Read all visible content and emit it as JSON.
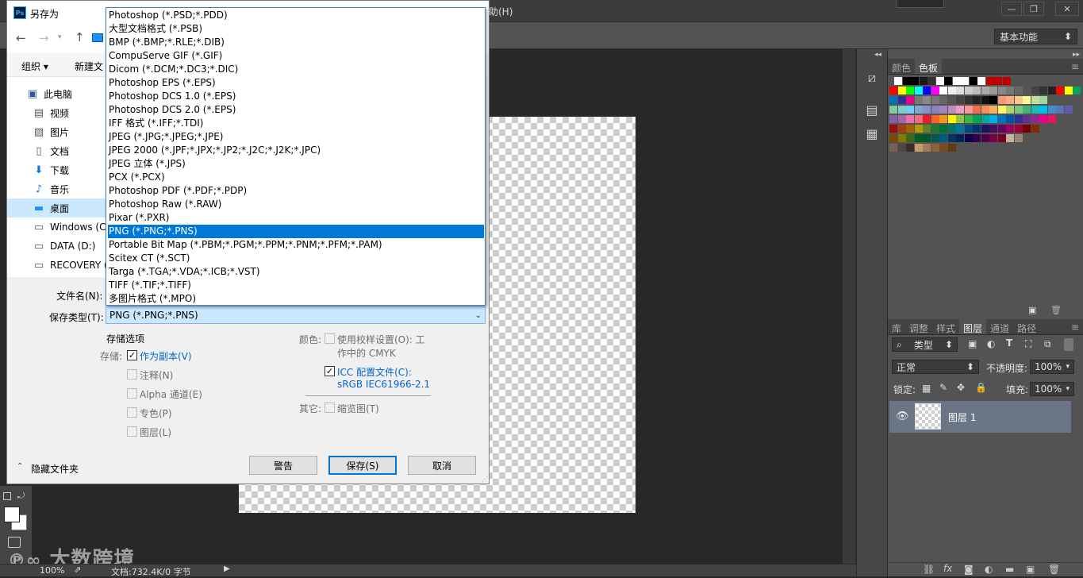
{
  "ps": {
    "menu_help": "助(H)",
    "window_controls": [
      "—",
      "❐",
      "✕"
    ],
    "workspace": "基本功能",
    "zoom": "100%",
    "doc_info": "文档:732.4K/0 字节",
    "watermark": "大数跨境"
  },
  "panels": {
    "color_tabs": [
      "颜色",
      "色板"
    ],
    "layer_tabs": [
      "库",
      "调整",
      "样式",
      "图层",
      "通道",
      "路径"
    ],
    "kind_filter": "类型",
    "blend_mode": "正常",
    "opacity_label": "不透明度:",
    "opacity_value": "100%",
    "lock_label": "锁定:",
    "fill_label": "填充:",
    "fill_value": "100%",
    "layer_name": "图层 1",
    "swatch_rows": [
      [
        "#ffffff",
        "#000000",
        "#000000",
        "#1a1a1a",
        "#333333",
        "#ffffff",
        "#000000",
        "#ffffff",
        "#ffffff",
        "#000000",
        "#ffffff",
        "#c00000",
        "#c00000",
        "#c00000"
      ],
      [
        "#ff0000",
        "#ffff00",
        "#00ff00",
        "#00ffff",
        "#0000ff",
        "#ff00ff",
        "#ffffff",
        "#eeeeee",
        "#dddddd",
        "#cccccc",
        "#bbbbbb",
        "#aaaaaa",
        "#999999",
        "#888888",
        "#777777",
        "#666666",
        "#555555",
        "#444444",
        "#333333",
        "#222222",
        "#ff0000",
        "#ffff00",
        "#00a651"
      ],
      [
        "#0072bc",
        "#2e3192",
        "#ec008c",
        "#777777",
        "#888888",
        "#777777",
        "#666666",
        "#555555",
        "#444444",
        "#333333",
        "#222222",
        "#111111",
        "#000000",
        "#f7977a",
        "#f9ad81",
        "#fdc68a",
        "#fff79a",
        "#c4df9b",
        "#a3d39c"
      ],
      [
        "#82ca9d",
        "#7bcdc8",
        "#6ecff6",
        "#7ea7d8",
        "#8493ca",
        "#8882be",
        "#a187be",
        "#bc8dbf",
        "#f49ac2",
        "#f6989d",
        "#f26c4f",
        "#f68e55",
        "#fbaf5c",
        "#fff467",
        "#acd372",
        "#7cc576",
        "#3bb878",
        "#1abbb4",
        "#00bff3",
        "#438ccb",
        "#5574b9",
        "#605ca8"
      ],
      [
        "#855fa8",
        "#a763a8",
        "#f06ea9",
        "#f26d7d",
        "#ed1c24",
        "#f26522",
        "#f7941d",
        "#fff200",
        "#8dc73f",
        "#39b54a",
        "#00a651",
        "#00a99d",
        "#00aeef",
        "#0072bc",
        "#0054a6",
        "#2e3192",
        "#662d91",
        "#92278f",
        "#ec008c",
        "#ed145b"
      ],
      [
        "#9e0b0f",
        "#a0410d",
        "#a36209",
        "#aba000",
        "#598527",
        "#1a7b30",
        "#007236",
        "#00746b",
        "#0076a3",
        "#004b80",
        "#003471",
        "#1b1464",
        "#440e62",
        "#630460",
        "#9e005d",
        "#9e0039",
        "#790000",
        "#7b2e00"
      ],
      [
        "#7d4900",
        "#827b00",
        "#406618",
        "#005e20",
        "#005826",
        "#005952",
        "#005b7f",
        "#003663",
        "#002157",
        "#0d004c",
        "#32004b",
        "#4b0049",
        "#7b0046",
        "#7a0026",
        "#c7b299",
        "#998675"
      ],
      [
        "#736357",
        "#534741",
        "#37302a",
        "#c69c6d",
        "#a67c52",
        "#8c6239",
        "#754c24",
        "#603913"
      ]
    ]
  },
  "dialog": {
    "title": "另存为",
    "organize": "组织 ▾",
    "new_folder": "新建文",
    "sidebar": [
      {
        "label": "此电脑",
        "icon": "pc-icon"
      },
      {
        "label": "视频",
        "icon": "video-icon"
      },
      {
        "label": "图片",
        "icon": "picture-icon"
      },
      {
        "label": "文档",
        "icon": "document-icon"
      },
      {
        "label": "下载",
        "icon": "download-icon"
      },
      {
        "label": "音乐",
        "icon": "music-icon"
      },
      {
        "label": "桌面",
        "icon": "desktop-icon"
      },
      {
        "label": "Windows (C",
        "icon": "drive-icon"
      },
      {
        "label": "DATA (D:)",
        "icon": "drive-icon"
      },
      {
        "label": "RECOVERY (",
        "icon": "drive-icon"
      }
    ],
    "filename_label": "文件名(N):",
    "filetype_label": "保存类型(T):",
    "filetype_value": "PNG (*.PNG;*.PNS)",
    "filetypes": [
      "Photoshop (*.PSD;*.PDD)",
      "大型文档格式 (*.PSB)",
      "BMP (*.BMP;*.RLE;*.DIB)",
      "CompuServe GIF (*.GIF)",
      "Dicom (*.DCM;*.DC3;*.DIC)",
      "Photoshop EPS (*.EPS)",
      "Photoshop DCS 1.0 (*.EPS)",
      "Photoshop DCS 2.0 (*.EPS)",
      "IFF 格式 (*.IFF;*.TDI)",
      "JPEG (*.JPG;*.JPEG;*.JPE)",
      "JPEG 2000 (*.JPF;*.JPX;*.JP2;*.J2C;*.J2K;*.JPC)",
      "JPEG 立体 (*.JPS)",
      "PCX (*.PCX)",
      "Photoshop PDF (*.PDF;*.PDP)",
      "Photoshop Raw (*.RAW)",
      "Pixar (*.PXR)",
      "PNG (*.PNG;*.PNS)",
      "Portable Bit Map (*.PBM;*.PGM;*.PPM;*.PNM;*.PFM;*.PAM)",
      "Scitex CT (*.SCT)",
      "Targa (*.TGA;*.VDA;*.ICB;*.VST)",
      "TIFF (*.TIF;*.TIFF)",
      "多图片格式 (*.MPO)"
    ],
    "selected_type_index": 16,
    "options_title": "存储选项",
    "save_label": "存储:",
    "as_copy": "作为副本(V)",
    "notes": "注释(N)",
    "alpha": "Alpha 通道(E)",
    "spot": "专色(P)",
    "layers": "图层(L)",
    "color_label": "颜色:",
    "use_proof": "使用校样设置(O): 工",
    "working_cmyk": "作中的 CMYK",
    "icc_profile": "ICC 配置文件(C):",
    "icc_value": "sRGB IEC61966-2.1",
    "other_label": "其它:",
    "thumbnail": "缩览图(T)",
    "hide_folders": "隐藏文件夹",
    "warning_btn": "警告",
    "save_btn": "保存(S)",
    "cancel_btn": "取消"
  }
}
